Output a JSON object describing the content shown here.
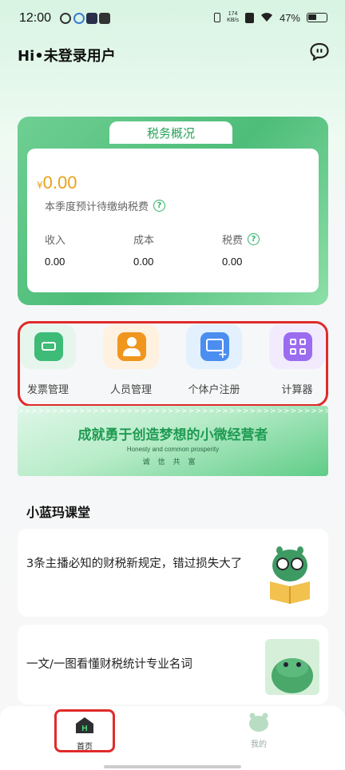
{
  "status_bar": {
    "time": "12:00",
    "net_speed_value": "174",
    "net_speed_unit": "KB/s",
    "battery": "47%"
  },
  "header": {
    "greeting": "Hi•未登录用户"
  },
  "tax_overview": {
    "tab_title": "税务概况",
    "currency_symbol": "¥",
    "amount": "0.00",
    "amount_label": "本季度预计待缴纳税费",
    "help_glyph": "?",
    "stats": [
      {
        "label": "收入",
        "value": "0.00"
      },
      {
        "label": "成本",
        "value": "0.00"
      },
      {
        "label": "税费",
        "value": "0.00"
      }
    ]
  },
  "quick_actions": [
    {
      "label": "发票管理",
      "icon": "invoice-icon",
      "color": "#3dbb77"
    },
    {
      "label": "人员管理",
      "icon": "person-icon",
      "color": "#f0961e"
    },
    {
      "label": "个体户注册",
      "icon": "register-icon",
      "color": "#4b8ef0"
    },
    {
      "label": "计算器",
      "icon": "calculator-icon",
      "color": "#9b6cf0"
    }
  ],
  "banner": {
    "arrows": ">>>>>>>>>>>>>>>>>>>>>>>>>>>>>>>>>>>>>>>>>>>>>>>>>>>>>>>>>>>>",
    "title": "成就勇于创造梦想的小微经营者",
    "subtitle": "Honesty and common prosperity",
    "motto": "诚信共富"
  },
  "classroom": {
    "title": "小蓝玛课堂",
    "articles": [
      {
        "text": "3条主播必知的财税新规定，错过损失大了"
      },
      {
        "text": "一文/一图看懂财税统计专业名词"
      }
    ]
  },
  "bottom_nav": {
    "home_label": "首页",
    "home_glyph": "H",
    "mine_label": "我的"
  },
  "colors": {
    "brand_green": "#2fb36a",
    "amount_orange": "#e8a21a",
    "highlight_red": "#e02a2a"
  }
}
